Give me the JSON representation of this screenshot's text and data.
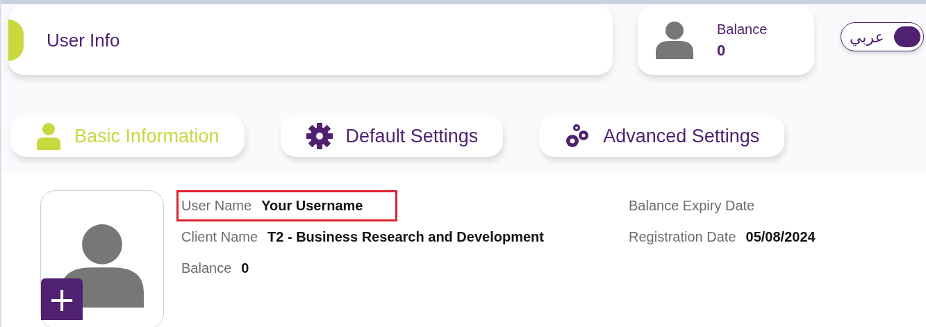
{
  "header": {
    "title": "User Info"
  },
  "balance_card": {
    "label": "Balance",
    "value": "0"
  },
  "language_toggle": {
    "label": "عربي",
    "on": true
  },
  "tabs": [
    {
      "label": "Basic Information",
      "kind": "user",
      "selected": true
    },
    {
      "label": "Default Settings",
      "kind": "gear",
      "selected": false
    },
    {
      "label": "Advanced Settings",
      "kind": "gears",
      "selected": false
    }
  ],
  "profile": {
    "columns": [
      [
        {
          "label": "User Name",
          "value": "Your Username",
          "highlighted": true
        },
        {
          "label": "Client Name",
          "value": "T2 - Business Research and Development",
          "highlighted": false
        },
        {
          "label": "Balance",
          "value": "0",
          "highlighted": false
        }
      ],
      [
        {
          "label": "Balance Expiry Date",
          "highlighted": false
        },
        {
          "label": "Registration Date",
          "value": "05/08/2024",
          "highlighted": false
        }
      ]
    ],
    "add_photo": "+"
  }
}
